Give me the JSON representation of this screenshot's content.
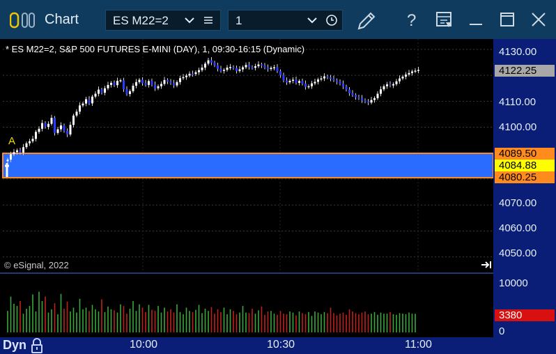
{
  "window": {
    "title": "Chart",
    "symbol_value": "ES M22=2",
    "interval_value": "1"
  },
  "chart": {
    "header": "* ES M22=2, S&P 500 FUTURES E-MINI (DAY), 1, 09:30-16:15 (Dynamic)",
    "copyright": "© eSignal, 2022",
    "last_price": "4122.25",
    "band_top": "4089.50",
    "band_mid": "4084.88",
    "band_bottom": "4080.25",
    "marker_label": "A",
    "price_axis": [
      "4130.00",
      "4110.00",
      "4100.00",
      "4070.00",
      "4060.00",
      "4050.00"
    ],
    "volume_axis": [
      "10000",
      "0"
    ],
    "volume_value": "3380",
    "time_axis": [
      "10:00",
      "10:30",
      "11:00"
    ],
    "status_label": "Dyn",
    "colors": {
      "up": "#3aa83a",
      "down": "#c0201c",
      "band": "#2a6cff",
      "band_border": "#ff8a1e",
      "mid_tag": "#ffff00",
      "last_tag": "#a8a8a8",
      "volume_tag": "#d81010",
      "axis_bg": "#0a1e78"
    }
  },
  "chart_data": {
    "type": "candlestick",
    "price_series": [
      4087.5,
      4089.6,
      4090.4,
      4091.1,
      4090.2,
      4092.3,
      4093.8,
      4094.6,
      4095.5,
      4098.2,
      4099.4,
      4101.6,
      4100.1,
      4101.3,
      4103.6,
      4097.8,
      4099.2,
      4100.7,
      4098.6,
      4097.2,
      4100.9,
      4104.5,
      4106.0,
      4108.4,
      4109.1,
      4110.8,
      4109.2,
      4111.8,
      4112.9,
      4114.5,
      4113.3,
      4115.0,
      4116.3,
      4117.1,
      4116.2,
      4117.9,
      4118.1,
      4114.6,
      4112.8,
      4113.9,
      4116.0,
      4117.4,
      4118.3,
      4117.0,
      4116.3,
      4117.8,
      4116.4,
      4115.0,
      4115.8,
      4116.7,
      4118.2,
      4117.6,
      4117.0,
      4116.1,
      4117.4,
      4118.9,
      4119.3,
      4119.9,
      4120.6,
      4120.5,
      4121.2,
      4122.0,
      4123.0,
      4124.5,
      4125.8,
      4124.9,
      4123.9,
      4122.5,
      4121.7,
      4122.1,
      4123.0,
      4123.2,
      4122.8,
      4121.7,
      4122.3,
      4123.1,
      4124.0,
      4123.2,
      4122.9,
      4123.5,
      4124.2,
      4123.8,
      4123.0,
      4122.4,
      4122.9,
      4123.1,
      4121.6,
      4120.1,
      4118.0,
      4117.3,
      4117.9,
      4118.3,
      4117.1,
      4117.8,
      4116.8,
      4115.5,
      4115.8,
      4116.9,
      4117.5,
      4118.4,
      4118.8,
      4119.6,
      4119.2,
      4118.7,
      4118.1,
      4117.5,
      4116.8,
      4115.7,
      4114.5,
      4113.1,
      4112.4,
      4111.6,
      4111.2,
      4110.4,
      4109.9,
      4109.5,
      4110.5,
      4111.2,
      4112.9,
      4114.6,
      4115.8,
      4116.5,
      4116.1,
      4116.6,
      4117.7,
      4118.8,
      4119.5,
      4120.3,
      4120.9,
      4121.5,
      4121.8,
      4122.1
    ],
    "volume_series": [
      3900,
      6500,
      5200,
      4800,
      5700,
      3400,
      4300,
      4800,
      6900,
      3800,
      7400,
      5700,
      6500,
      3600,
      4200,
      5300,
      3300,
      7000,
      4300,
      5600,
      3800,
      4500,
      3600,
      6100,
      4200,
      4500,
      3900,
      5000,
      4200,
      3800,
      6000,
      3700,
      4700,
      4200,
      4000,
      3600,
      5100,
      4800,
      3400,
      4300,
      5700,
      3900,
      5100,
      4500,
      3700,
      5000,
      4100,
      3900,
      4800,
      3600,
      4500,
      3800,
      4200,
      3600,
      5100,
      3700,
      3300,
      4500,
      3900,
      3700,
      4100,
      5000,
      3500,
      4300,
      3900,
      4600,
      3400,
      4200,
      3700,
      4500,
      3300,
      4200,
      3900,
      3300,
      3600,
      4800,
      3600,
      3500,
      4300,
      3400,
      4000,
      4700,
      3200,
      3800,
      3900,
      3400,
      3200,
      3900,
      3400,
      3300,
      3800,
      3600,
      3100,
      3800,
      3500,
      3300,
      3700,
      3000,
      3800,
      3600,
      3300,
      3700,
      3500,
      4500,
      3500,
      3100,
      3400,
      3600,
      3200,
      4200,
      3800,
      3500,
      3300,
      3600,
      3800,
      3300,
      3400,
      3700,
      3200,
      3600,
      3400,
      3400,
      3700,
      3300,
      3200,
      3500,
      3400,
      3300,
      3600,
      3400,
      3380
    ],
    "y_range": [
      4044,
      4134
    ],
    "volume_range": [
      0,
      10000
    ]
  }
}
